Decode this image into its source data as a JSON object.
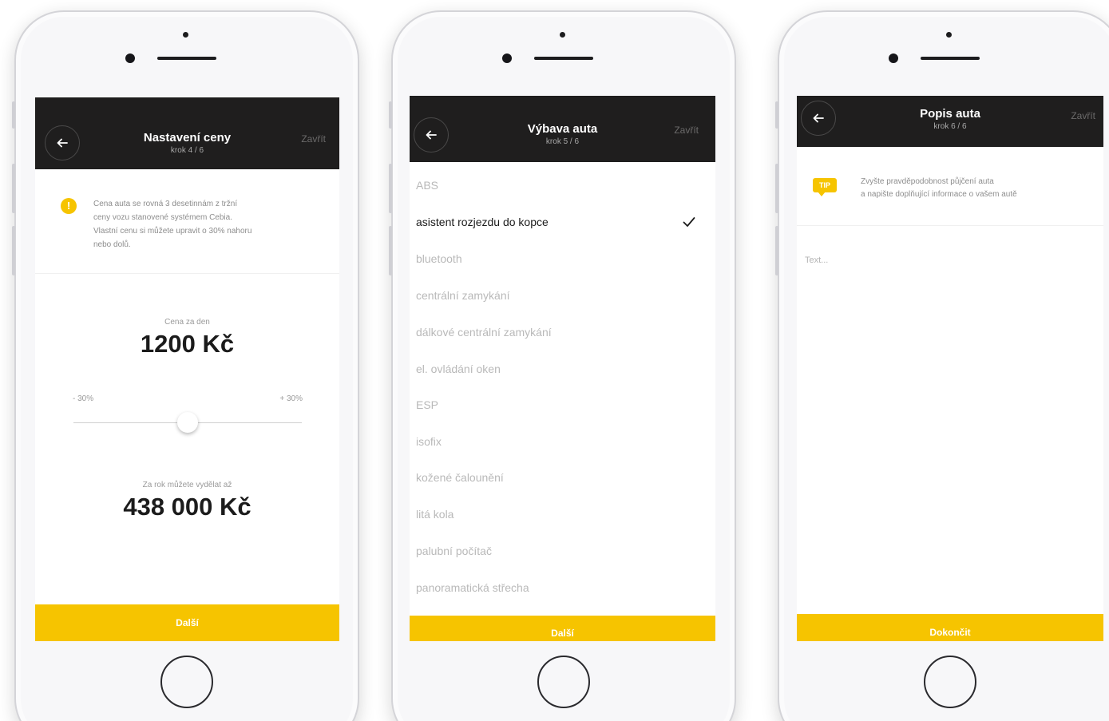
{
  "colors": {
    "accent_yellow": "#f6c400",
    "appbar_dark": "#1f1e1e",
    "text_dark": "#1b1b1b",
    "text_muted": "#b9b9b9"
  },
  "screen_price": {
    "title": "Nastavení ceny",
    "step": "krok 4 / 6",
    "close_label": "Zavřít",
    "notice_icon": "exclamation-icon",
    "notice_lines": [
      "Cena auta se rovná 3 desetinnám z tržní",
      "ceny vozu stanovené systémem Cebia.",
      "Vlastní cenu si můžete upravit o 30% nahoru",
      "nebo dolů."
    ],
    "price_label": "Cena za den",
    "price_value": "1200 Kč",
    "slider_min_label": "- 30%",
    "slider_max_label": "+ 30%",
    "slider_value_fraction": 0.5,
    "yearly_label": "Za rok můžete vydělat až",
    "yearly_value": "438 000 Kč",
    "cta_label": "Další"
  },
  "screen_equipment": {
    "title": "Výbava auta",
    "step": "krok 5 / 6",
    "close_label": "Zavřít",
    "items": [
      {
        "label": "ABS",
        "selected": false
      },
      {
        "label": "asistent rozjezdu do kopce",
        "selected": true
      },
      {
        "label": "bluetooth",
        "selected": false
      },
      {
        "label": "centrální zamykání",
        "selected": false
      },
      {
        "label": "dálkové centrální zamykání",
        "selected": false
      },
      {
        "label": "el. ovládání oken",
        "selected": false
      },
      {
        "label": "ESP",
        "selected": false
      },
      {
        "label": "isofix",
        "selected": false
      },
      {
        "label": "kožené čalounění",
        "selected": false
      },
      {
        "label": "litá kola",
        "selected": false
      },
      {
        "label": "palubní počítač",
        "selected": false
      },
      {
        "label": "panoramatická střecha",
        "selected": false
      }
    ],
    "cta_label": "Další"
  },
  "screen_description": {
    "title": "Popis auta",
    "step": "krok 6 / 6",
    "close_label": "Zavřít",
    "tip_badge": "TIP",
    "tip_lines": [
      "Zvyšte pravděpodobnost půjčení auta",
      "a napište doplňující informace o vašem autě"
    ],
    "text_placeholder": "Text...",
    "cta_label": "Dokončit"
  }
}
